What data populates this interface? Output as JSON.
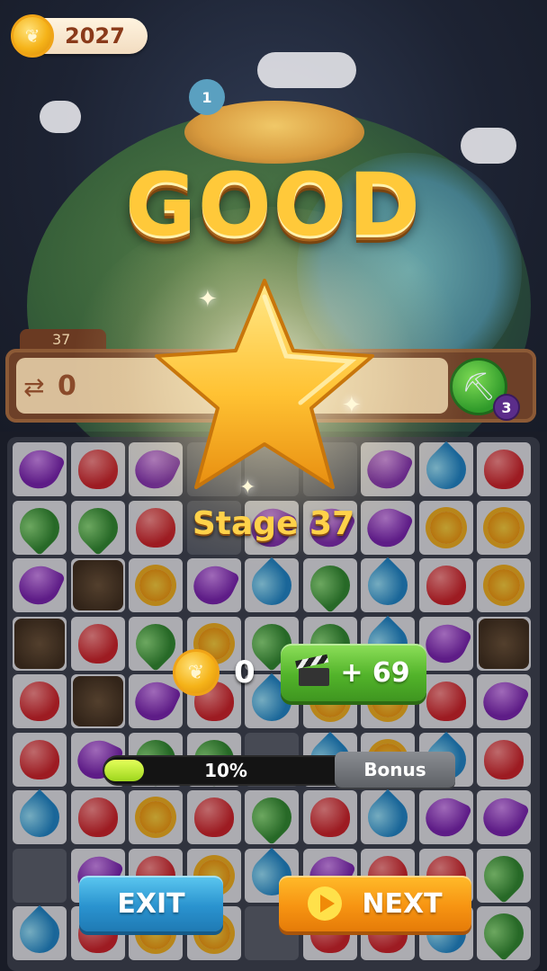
{
  "header": {
    "coins": "2027",
    "coin_icon": "coin-icon"
  },
  "result": {
    "title": "GOOD",
    "stage": "Stage 37"
  },
  "level_bar": {
    "level": "37",
    "swaps": "0",
    "tool_count": "3",
    "tool_icon": "shovel-icon"
  },
  "reward": {
    "coins": "0",
    "video_bonus": "+ 69",
    "video_icon": "clapperboard-icon"
  },
  "progress": {
    "percent_text": "10%",
    "percent": 10,
    "bonus_label": "Bonus"
  },
  "buttons": {
    "exit": "EXIT",
    "next": "NEXT"
  },
  "colors": {
    "title": "#ffc93a",
    "exit": "#2a93cf",
    "next": "#f79412",
    "video": "#52b32a"
  },
  "board": [
    [
      "purple",
      "red",
      "purple",
      "dark",
      "dark",
      "dark",
      "purple",
      "blue",
      "red"
    ],
    [
      "green",
      "green",
      "red",
      "dark",
      "purple",
      "purple",
      "purple",
      "yellow",
      "yellow"
    ],
    [
      "purple",
      "dirt",
      "yellow",
      "purple",
      "blue",
      "green",
      "blue",
      "red",
      "yellow"
    ],
    [
      "dirt",
      "red",
      "green",
      "yellow",
      "green",
      "green",
      "blue",
      "purple",
      "dirt"
    ],
    [
      "red",
      "dirt",
      "purple",
      "red",
      "blue",
      "yellow",
      "yellow",
      "red",
      "purple"
    ],
    [
      "red",
      "purple",
      "green",
      "green",
      "dark",
      "blue",
      "yellow",
      "blue",
      "red"
    ],
    [
      "blue",
      "red",
      "yellow",
      "red",
      "green",
      "red",
      "blue",
      "purple",
      "purple"
    ],
    [
      "dark",
      "purple",
      "red",
      "yellow",
      "blue",
      "purple",
      "red",
      "red",
      "green"
    ],
    [
      "blue",
      "red",
      "yellow",
      "yellow",
      "dark",
      "red",
      "red",
      "blue",
      "green"
    ]
  ]
}
